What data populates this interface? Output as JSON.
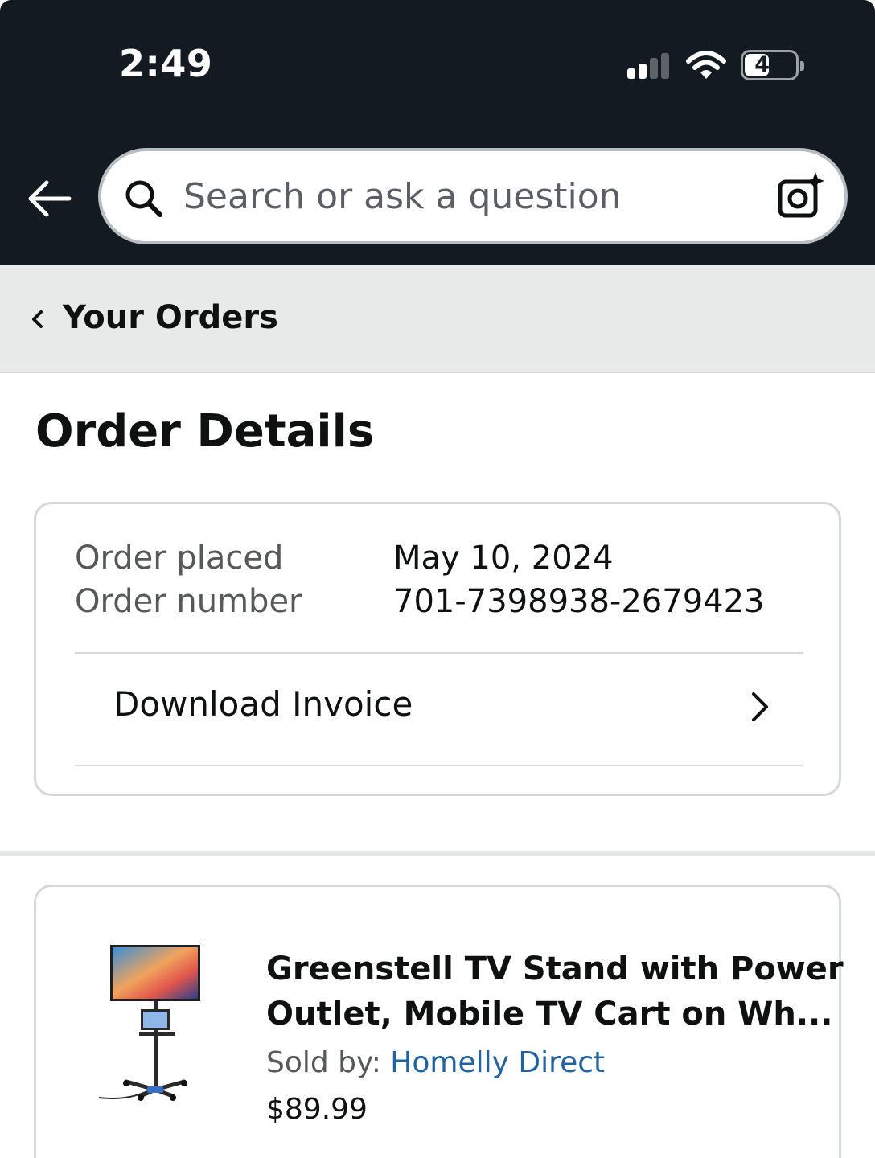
{
  "status_bar": {
    "time": "2:49",
    "battery": "44"
  },
  "search": {
    "placeholder": "Search or ask a question"
  },
  "breadcrumb": {
    "label": "Your Orders"
  },
  "page": {
    "title": "Order Details"
  },
  "order": {
    "placed_label": "Order placed",
    "placed_value": "May 10, 2024",
    "number_label": "Order number",
    "number_value": "701-7398938-2679423",
    "invoice_label": "Download Invoice"
  },
  "product": {
    "name_line1": "Greenstell TV Stand with Power",
    "name_line2": "Outlet, Mobile TV Cart on Wh...",
    "sold_by_label": "Sold by:",
    "seller": "Homelly Direct",
    "price": "$89.99"
  },
  "colors": {
    "header_bg": "#131a22",
    "link": "#2162a1",
    "breadcrumb_bg": "#e8eaea"
  },
  "icons": [
    "back-arrow-icon",
    "search-icon",
    "camera-icon",
    "chevron-left-icon",
    "chevron-right-icon",
    "signal-icon",
    "wifi-icon",
    "battery-icon"
  ]
}
